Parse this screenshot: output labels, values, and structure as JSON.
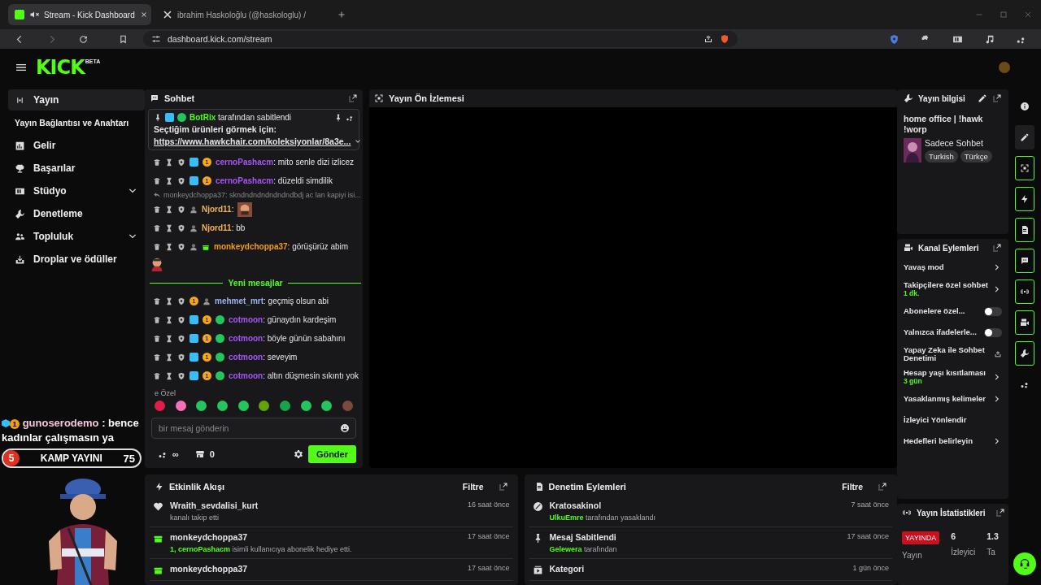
{
  "browser": {
    "tabs": [
      {
        "title": "Stream - Kick Dashboard",
        "selected": true,
        "muted": true
      },
      {
        "title": "ibrahim Haskoloğlu (@haskologlu) /",
        "selected": false,
        "muted": false
      }
    ],
    "url": "dashboard.kick.com/stream"
  },
  "header": {
    "logo": "KICK",
    "logo_badge": "BETA"
  },
  "sidebar": {
    "items": [
      {
        "label": "Yayın",
        "selected": true,
        "expandable": false,
        "children": [
          {
            "label": "Yayın Bağlantısı ve Anahtarı",
            "selected": false
          }
        ]
      },
      {
        "label": "Gelir",
        "selected": false,
        "expandable": false
      },
      {
        "label": "Başarılar",
        "selected": false,
        "expandable": false
      },
      {
        "label": "Stüdyo",
        "selected": false,
        "expandable": true
      },
      {
        "label": "Denetleme",
        "selected": false,
        "expandable": false
      },
      {
        "label": "Topluluk",
        "selected": false,
        "expandable": true
      },
      {
        "label": "Droplar ve ödüller",
        "selected": false,
        "expandable": false
      }
    ]
  },
  "overlay": {
    "badge": "1",
    "username": "gunoserodemo",
    "message": ": bence kadınlar çalışmasın ya",
    "rank": "5",
    "title": "KAMP YAYINI",
    "count": "75"
  },
  "chat": {
    "title": "Sohbet",
    "pinned": {
      "author": "BotRix",
      "note": "tarafından sabitlendi",
      "text": "Seçtiğim ürünleri görmek için:",
      "link": "https://www.hawkchair.com/koleksiyonlar/8a3e..."
    },
    "messages": [
      {
        "kind": "message",
        "username": "cernoPashacm",
        "color": "#a855f7",
        "badges": [
          {
            "kind": "mod"
          },
          {
            "kind": "sub",
            "label": "1"
          }
        ],
        "text": ": mito senle dizi izlicez"
      },
      {
        "kind": "message",
        "username": "cernoPashacm",
        "color": "#a855f7",
        "badges": [
          {
            "kind": "mod"
          },
          {
            "kind": "sub",
            "label": "1"
          }
        ],
        "text": ": düzeldi simdilik"
      },
      {
        "kind": "reply",
        "text": "monkeydchoppa37: skndndndndndndndbdj ac lan kapiyi isi..."
      },
      {
        "kind": "message",
        "username": "Njord11",
        "color": "#f0b35a",
        "badges": [
          {
            "kind": "avatar"
          }
        ],
        "text": ":",
        "emote": true
      },
      {
        "kind": "message",
        "username": "Njord11",
        "color": "#f0b35a",
        "badges": [
          {
            "kind": "avatar"
          }
        ],
        "text": ": bb"
      },
      {
        "kind": "message",
        "username": "monkeydchoppa37",
        "color": "#f59e0b",
        "badges": [
          {
            "kind": "avatar"
          },
          {
            "kind": "gift"
          }
        ],
        "text": ": görüşürüz abim",
        "sticker": true
      },
      {
        "kind": "divider",
        "text": "Yeni mesajlar"
      },
      {
        "kind": "message",
        "username": "mehmet_mrt",
        "color": "#9bb4f0",
        "badges": [
          {
            "kind": "sub",
            "label": "1"
          },
          {
            "kind": "avatar"
          }
        ],
        "text": ": geçmiş olsun abi"
      },
      {
        "kind": "message",
        "username": "cotmoon",
        "color": "#a855f7",
        "badges": [
          {
            "kind": "mod"
          },
          {
            "kind": "sub",
            "label": "1"
          },
          {
            "kind": "verified"
          }
        ],
        "text": ": günaydın kardeşim"
      },
      {
        "kind": "message",
        "username": "cotmoon",
        "color": "#a855f7",
        "badges": [
          {
            "kind": "mod"
          },
          {
            "kind": "sub",
            "label": "1"
          },
          {
            "kind": "verified"
          }
        ],
        "text": ": böyle günün sabahını"
      },
      {
        "kind": "message",
        "username": "cotmoon",
        "color": "#a855f7",
        "badges": [
          {
            "kind": "mod"
          },
          {
            "kind": "sub",
            "label": "1"
          },
          {
            "kind": "verified"
          }
        ],
        "text": ": seveyim"
      },
      {
        "kind": "message",
        "username": "cotmoon",
        "color": "#a855f7",
        "badges": [
          {
            "kind": "mod"
          },
          {
            "kind": "sub",
            "label": "1"
          },
          {
            "kind": "verified"
          }
        ],
        "text": ": altın düşmesin sıkıntı yok"
      }
    ],
    "emote_label": "e Özel",
    "emotes": [
      {
        "color": "#e11d48"
      },
      {
        "color": "#f472b6"
      },
      {
        "color": "#22c55e"
      },
      {
        "color": "#22c55e"
      },
      {
        "color": "#22c55e"
      },
      {
        "color": "#65a30d"
      },
      {
        "color": "#16a34a"
      },
      {
        "color": "#22c55e"
      },
      {
        "color": "#22c55e"
      },
      {
        "color": "#7c4a3a"
      }
    ],
    "placeholder": "bir mesaj gönderin",
    "points": "∞",
    "shop_count": "0",
    "send": "Gönder"
  },
  "preview": {
    "title": "Yayın Ön İzlemesi"
  },
  "stream_info": {
    "title": "Yayın bilgisi",
    "stream_title": "home office | !hawk !worp",
    "category": "Sadece Sohbet",
    "tags": [
      "Turkish",
      "Türkçe"
    ]
  },
  "channel_actions": {
    "title": "Kanal Eylemleri",
    "items": [
      {
        "kind": "link",
        "label": "Yavaş mod"
      },
      {
        "kind": "link",
        "label": "Takipçilere özel sohbet",
        "value": "1 dk."
      },
      {
        "kind": "toggle",
        "label": "Abonelere özel...",
        "on": false
      },
      {
        "kind": "toggle",
        "label": "Yalnızca ifadelerle...",
        "on": false
      },
      {
        "kind": "external",
        "label": "Yapay Zeka ile Sohbet Denetimi"
      },
      {
        "kind": "link",
        "label": "Hesap yaşı kısıtlaması",
        "value": "3 gün"
      },
      {
        "kind": "link",
        "label": "Yasaklanmış kelimeler"
      },
      {
        "kind": "plain",
        "label": "İzleyici Yönlendir"
      },
      {
        "kind": "link",
        "label": "Hedefleri belirleyin"
      }
    ]
  },
  "stats": {
    "title": "Yayın İstatistikleri",
    "items": [
      {
        "kind": "live",
        "badge": "YAYINDA",
        "label": "Yayın"
      },
      {
        "kind": "number",
        "value": "6",
        "label": "İzleyici"
      },
      {
        "kind": "number",
        "value": "1.3",
        "label": "Ta"
      }
    ]
  },
  "activity": {
    "title": "Etkinlik Akışı",
    "filter": "Filtre",
    "items": [
      {
        "kind": "follow",
        "name": "Wraith_sevdalisi_kurt",
        "detail": "kanalı takip etti",
        "time": "16 saat önce"
      },
      {
        "kind": "gift",
        "name": "monkeydchoppa37",
        "actor": "1, cernoPashacm",
        "detail": " isimli kullanıcıya abonelik hediye etti.",
        "time": "17 saat önce"
      },
      {
        "kind": "gift",
        "name": "monkeydchoppa37",
        "time": "17 saat önce"
      }
    ]
  },
  "moderation": {
    "title": "Denetim Eylemleri",
    "filter": "Filtre",
    "items": [
      {
        "kind": "ban",
        "name": "Kratosakinol",
        "actor": "UlkuEmre",
        "detail": " tarafından yasaklandı",
        "time": "7 saat önce"
      },
      {
        "kind": "pin",
        "name": "Mesaj Sabitlendi",
        "actor": "Gelewera",
        "detail": " tarafından",
        "time": "17 saat önce"
      },
      {
        "kind": "category",
        "name": "Kategori",
        "time": "1 gün önce"
      }
    ]
  },
  "rail": {
    "items": [
      {
        "selected": false,
        "outlined": false
      },
      {
        "selected": true,
        "outlined": false
      },
      {
        "selected": false,
        "outlined": true
      },
      {
        "selected": false,
        "outlined": true
      },
      {
        "selected": false,
        "outlined": true
      },
      {
        "selected": false,
        "outlined": true
      },
      {
        "selected": false,
        "outlined": true
      },
      {
        "selected": false,
        "outlined": true
      },
      {
        "selected": false,
        "outlined": true
      },
      {
        "selected": false,
        "outlined": false
      }
    ]
  }
}
